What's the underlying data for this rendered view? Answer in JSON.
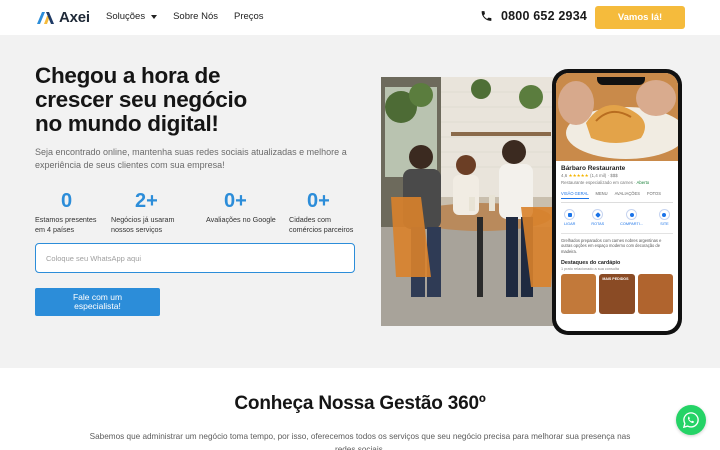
{
  "nav": {
    "logo_text": "Axei",
    "menu": [
      {
        "label": "Soluções",
        "has_dropdown": true
      },
      {
        "label": "Sobre Nós",
        "has_dropdown": false
      },
      {
        "label": "Preços",
        "has_dropdown": false
      }
    ],
    "phone": "0800 652 2934",
    "cta": "Vamos lá!"
  },
  "hero": {
    "headline": [
      "Chegou a hora de",
      "crescer seu negócio",
      "no mundo digital!"
    ],
    "subtext": "Seja encontrado online, mantenha suas redes sociais atualizadas e melhore a experiência de seus clientes com sua empresa!",
    "stats": [
      {
        "value": "0",
        "label_lines": [
          "Estamos presentes",
          "em 4 países"
        ]
      },
      {
        "value": "2+",
        "label_lines": [
          "Negócios já usaram",
          "nossos serviços"
        ]
      },
      {
        "value": "0+",
        "label_lines": [
          "Avaliações no Google"
        ]
      },
      {
        "value": "0+",
        "label_lines": [
          "Cidades com",
          "comércios parceiros"
        ]
      }
    ],
    "whatsapp_placeholder": "Coloque seu WhatsApp aqui",
    "specialist_button_lines": [
      "Fale com um",
      "especialista!"
    ]
  },
  "business_card": {
    "name": "Bárbaro Restaurante",
    "rating": "4,6",
    "stars": "★★★★★",
    "reviews": "(1,4 mil)",
    "price": "$$$",
    "category": "Restaurante especializado em carnes",
    "status": "Aberto",
    "tabs": [
      "VISÃO GERAL",
      "MENU",
      "AVALIAÇÕES",
      "FOTOS"
    ],
    "actions": [
      "LIGAR",
      "ROTAS",
      "COMPARTI...",
      "SITE"
    ],
    "description": "Grelhados preparados com carnes nobres argentinas e outras opções em espaço moderno com decoração de madeira.",
    "menu_title": "Destaques do cardápio",
    "menu_subtitle": "1 prato relacionado a sua consulta",
    "thumb_label": "MAIS PEDIDOS"
  },
  "section": {
    "title": "Conheça Nossa Gestão 360º",
    "text": "Sabemos que administrar um negócio toma tempo, por isso, oferecemos todos os serviços que seu negócio precisa para melhorar sua presença nas redes sociais."
  },
  "colors": {
    "accent_blue": "#2c8dd9",
    "cta_yellow": "#f5bb3c",
    "whatsapp_green": "#25d366",
    "hero_bg": "#f2f2f2"
  },
  "icons": {
    "phone": "phone-icon",
    "whatsapp": "whatsapp-icon",
    "dropdown": "chevron-down-icon"
  }
}
